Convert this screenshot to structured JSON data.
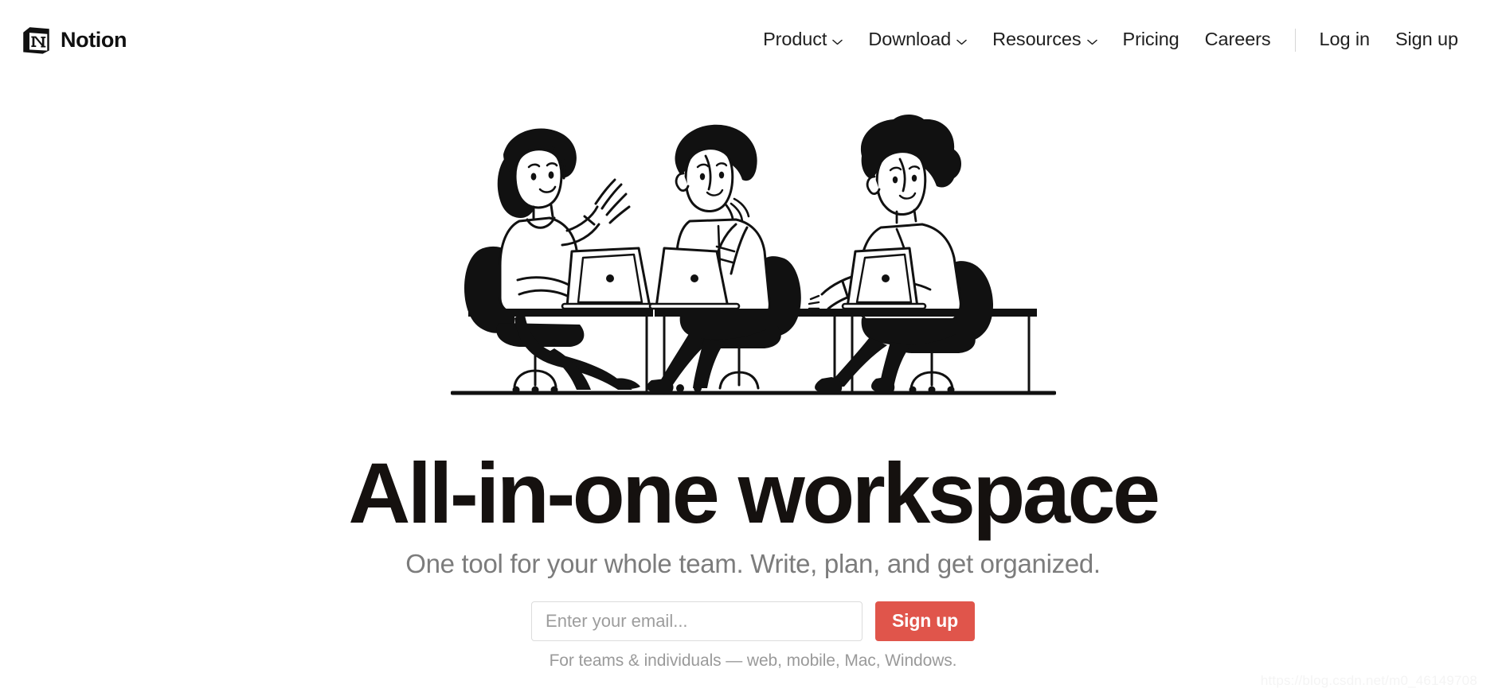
{
  "brand": {
    "name": "Notion",
    "logo_icon": "notion-cube-icon",
    "logo_letter": "N"
  },
  "nav": {
    "items": [
      {
        "label": "Product",
        "has_dropdown": true,
        "icon": "chevron-down-icon"
      },
      {
        "label": "Download",
        "has_dropdown": true,
        "icon": "chevron-down-icon"
      },
      {
        "label": "Resources",
        "has_dropdown": true,
        "icon": "chevron-down-icon"
      },
      {
        "label": "Pricing",
        "has_dropdown": false,
        "icon": ""
      },
      {
        "label": "Careers",
        "has_dropdown": false,
        "icon": ""
      }
    ],
    "auth": [
      {
        "label": "Log in"
      },
      {
        "label": "Sign up"
      }
    ]
  },
  "hero": {
    "illustration_name": "three-people-at-laptops-illustration",
    "headline": "All-in-one workspace",
    "subhead": "One tool for your whole team. Write, plan, and get organized.",
    "email_placeholder": "Enter your email...",
    "email_value": "",
    "signup_button": "Sign up",
    "form_note": "For teams & individuals — web, mobile, Mac, Windows."
  },
  "watermark": {
    "text": "https://blog.csdn.net/m0_46149708"
  },
  "colors": {
    "accent": "#e0554b",
    "text_primary": "#15110f",
    "text_secondary": "#7c7c7c",
    "text_muted": "#9a9a9a",
    "border": "#dcdcdc",
    "background": "#ffffff"
  }
}
